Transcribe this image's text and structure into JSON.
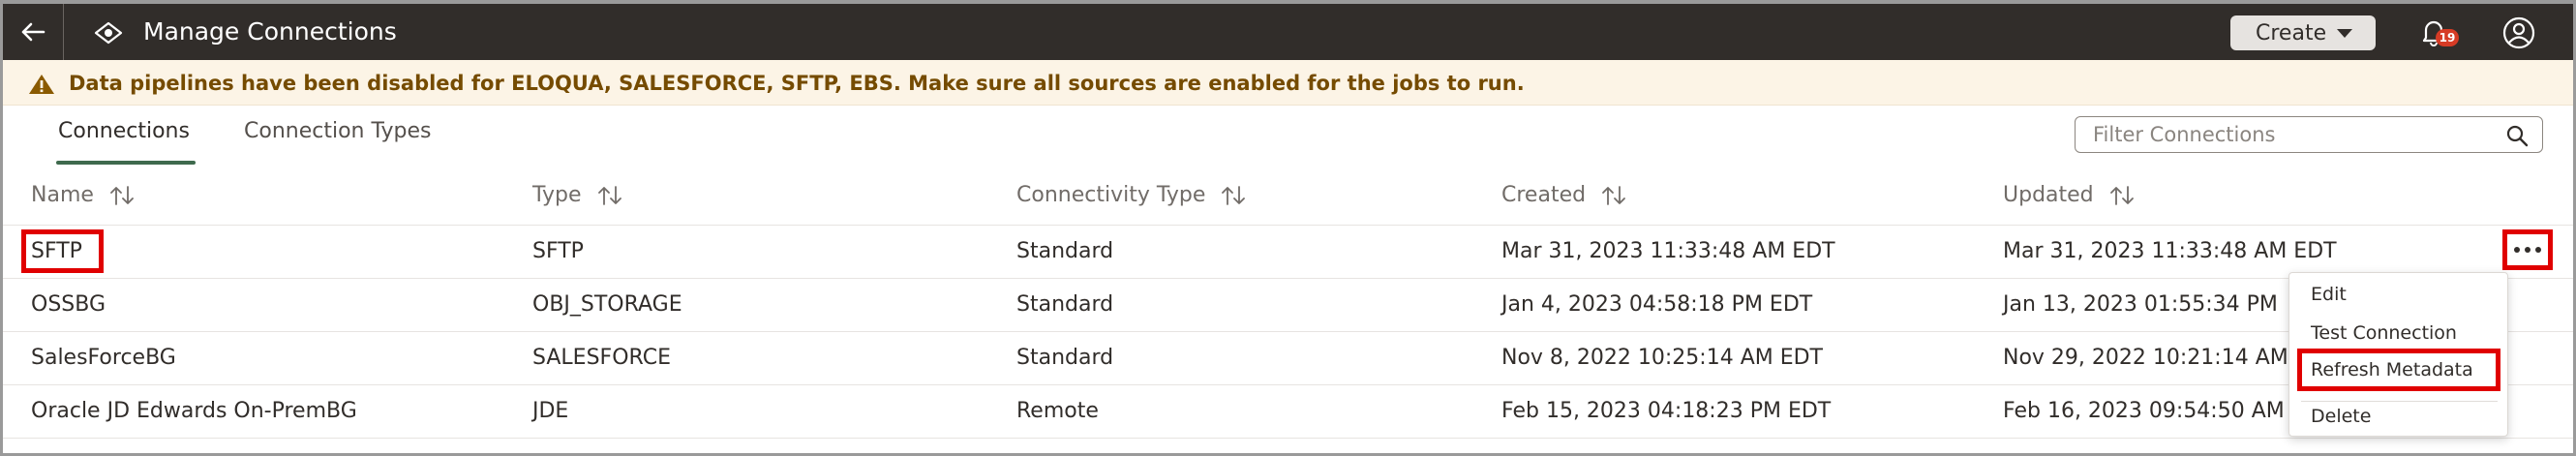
{
  "header": {
    "title": "Manage Connections",
    "create_label": "Create",
    "notification_count": "19",
    "icons": {
      "back": "back-arrow-icon",
      "app": "eye-icon",
      "bell": "bell-icon",
      "user": "user-icon"
    }
  },
  "banner": {
    "text": "Data pipelines have been disabled for ELOQUA, SALESFORCE, SFTP, EBS. Make sure all sources are enabled for the jobs to run.",
    "icon": "warning-icon"
  },
  "tabs": [
    {
      "label": "Connections",
      "selected": true
    },
    {
      "label": "Connection Types",
      "selected": false
    }
  ],
  "filter": {
    "placeholder": "Filter Connections",
    "value": ""
  },
  "table": {
    "columns": [
      "Name",
      "Type",
      "Connectivity Type",
      "Created",
      "Updated"
    ],
    "rows": [
      {
        "name": "SFTP",
        "type": "SFTP",
        "connectivity": "Standard",
        "created": "Mar 31, 2023 11:33:48 AM EDT",
        "updated": "Mar 31, 2023 11:33:48 AM EDT"
      },
      {
        "name": "OSSBG",
        "type": "OBJ_STORAGE",
        "connectivity": "Standard",
        "created": "Jan 4, 2023 04:58:18 PM EDT",
        "updated": "Jan 13, 2023 01:55:34 PM"
      },
      {
        "name": "SalesForceBG",
        "type": "SALESFORCE",
        "connectivity": "Standard",
        "created": "Nov 8, 2022 10:25:14 AM EDT",
        "updated": "Nov 29, 2022 10:21:14 AM"
      },
      {
        "name": "Oracle JD Edwards On-PremBG",
        "type": "JDE",
        "connectivity": "Remote",
        "created": "Feb 15, 2023 04:18:23 PM EDT",
        "updated": "Feb 16, 2023 09:54:50 AM"
      }
    ]
  },
  "menu": {
    "items": [
      "Edit",
      "Test Connection",
      "Refresh Metadata",
      "Delete"
    ]
  },
  "colors": {
    "header_bg": "#312d2a",
    "banner_bg": "#fcf4e6",
    "banner_text": "#754b00",
    "tab_accent": "#3e6a4d",
    "highlight": "#e00000",
    "badge": "#d63b25"
  }
}
